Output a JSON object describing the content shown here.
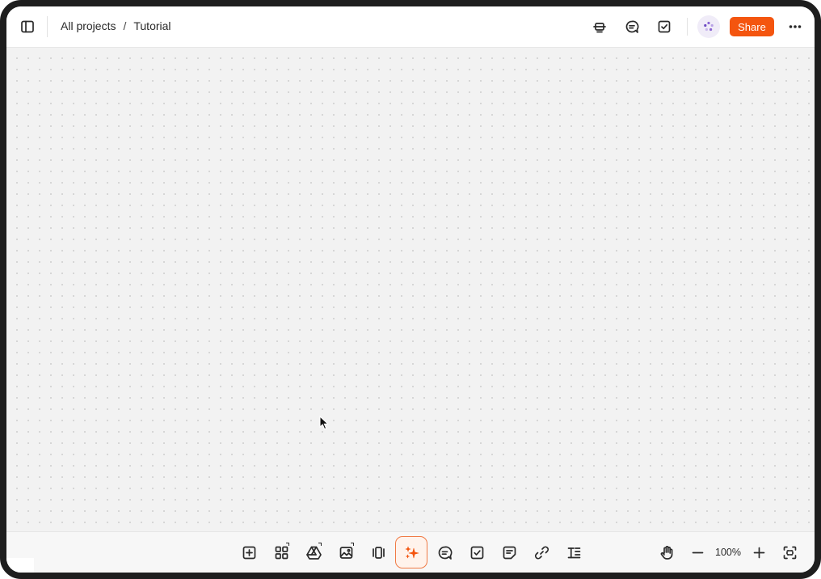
{
  "breadcrumb": {
    "parent": "All projects",
    "separator": "/",
    "current": "Tutorial"
  },
  "header": {
    "share_label": "Share"
  },
  "toolbar": {
    "zoom_level": "100%",
    "tools": [
      {
        "icon": "add-frame-icon"
      },
      {
        "icon": "apps-grid-icon"
      },
      {
        "icon": "google-drive-icon"
      },
      {
        "icon": "image-icon"
      },
      {
        "icon": "carousel-icon"
      },
      {
        "icon": "ai-sparkle-icon"
      },
      {
        "icon": "comment-icon"
      },
      {
        "icon": "task-checkbox-icon"
      },
      {
        "icon": "note-icon"
      },
      {
        "icon": "link-icon"
      },
      {
        "icon": "text-format-icon"
      }
    ]
  },
  "colors": {
    "accent": "#f4550f",
    "canvas": "#f2f2f2",
    "frame": "#1e1e1e"
  }
}
